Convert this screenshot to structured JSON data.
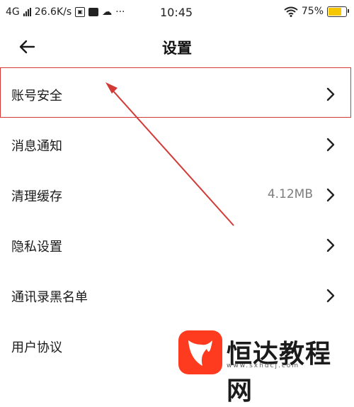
{
  "status_bar": {
    "network": "4G",
    "speed": "26.6K/s",
    "time": "10:45",
    "dots": "···",
    "battery": "75%",
    "battery_percent": 75
  },
  "header": {
    "title": "设置"
  },
  "settings": [
    {
      "label": "账号安全",
      "value": ""
    },
    {
      "label": "消息通知",
      "value": ""
    },
    {
      "label": "清理缓存",
      "value": "4.12MB"
    },
    {
      "label": "隐私设置",
      "value": ""
    },
    {
      "label": "通讯录黑名单",
      "value": ""
    },
    {
      "label": "用户协议",
      "value": ""
    }
  ],
  "watermark": {
    "text": "恒达教程网",
    "url": "www.sxhdcj.com"
  },
  "colors": {
    "annotation_red": "#d23a36",
    "watermark_logo": "#ff3b1f",
    "value_gray": "#7d7d7d"
  }
}
